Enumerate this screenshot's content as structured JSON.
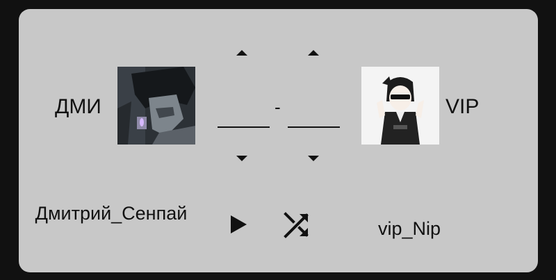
{
  "match": {
    "left_team": {
      "short_name": "ДМИ",
      "player_name": "Дмитрий_Сенпай",
      "score": ""
    },
    "right_team": {
      "short_name": "VIP",
      "player_name": "vip_Nip",
      "score": ""
    },
    "score_separator": "-"
  },
  "icons": {
    "play": "play-icon",
    "shuffle": "shuffle-icon",
    "score_up": "arrow-up-icon",
    "score_down": "arrow-down-icon"
  },
  "colors": {
    "card_bg": "#c8c8c8",
    "page_bg": "#111111",
    "text": "#111111"
  }
}
